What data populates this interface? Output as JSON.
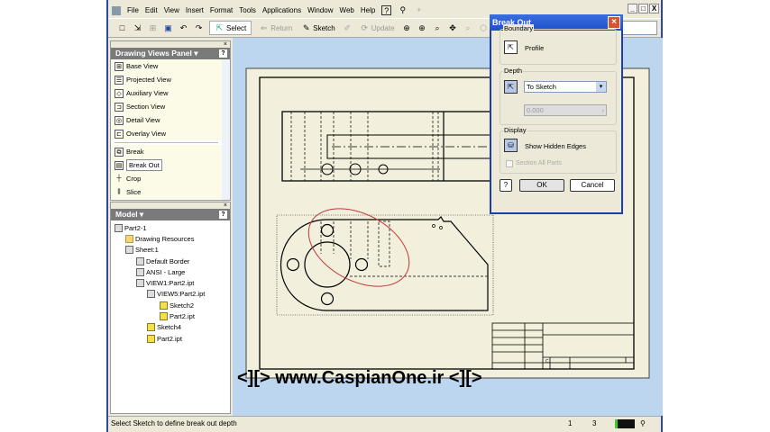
{
  "menu": [
    "File",
    "Edit",
    "View",
    "Insert",
    "Format",
    "Tools",
    "Applications",
    "Window",
    "Web",
    "Help"
  ],
  "window_controls": [
    "_",
    "□",
    "X"
  ],
  "toolbar": {
    "select": "Select",
    "return": "Return",
    "sketch": "Sketch",
    "update": "Update"
  },
  "drawing_views_panel": {
    "title": "Drawing Views Panel ▾",
    "help": "?",
    "items": [
      "Base View",
      "Projected View",
      "Auxiliary View",
      "Section View",
      "Detail View",
      "Overlay View"
    ],
    "items2": [
      "Break",
      "Break Out",
      "Crop",
      "Slice"
    ],
    "active": "Break Out"
  },
  "model_panel": {
    "title": "Model ▾",
    "help": "?",
    "tree": [
      "Part2-1",
      "Drawing Resources",
      "Sheet:1",
      "Default Border",
      "ANSI - Large",
      "VIEW1:Part2.ipt",
      "VIEW5:Part2.ipt",
      "Sketch2",
      "Part2.ipt",
      "Sketch4",
      "Part2.ipt"
    ]
  },
  "dialog": {
    "title": "Break Out",
    "boundary_label": "Boundary",
    "profile": "Profile",
    "depth_label": "Depth",
    "depth_option": "To Sketch",
    "depth_value": "0.000",
    "display_label": "Display",
    "show_hidden": "Show Hidden Edges",
    "section_all": "Section All Parts",
    "ok": "OK",
    "cancel": "Cancel",
    "help": "?"
  },
  "title_block": {
    "size": "C"
  },
  "watermark": "<][> www.CaspianOne.ir <][>",
  "status": {
    "message": "Select Sketch to define break out depth",
    "n1": "1",
    "n2": "3"
  }
}
